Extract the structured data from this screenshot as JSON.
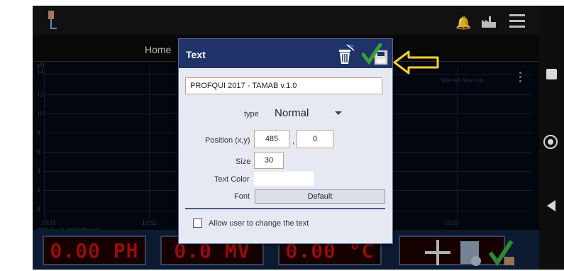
{
  "tabs": {
    "home": "Home"
  },
  "graph": {
    "ylabel": "pH",
    "yticks": [
      "14",
      "12",
      "10",
      "8",
      "6",
      "4",
      "2",
      "0"
    ],
    "xticks": [
      "10:51",
      "10:52",
      "10:55"
    ],
    "minmax": "Min=0.0  Max=0.0",
    "timestamp": "2019 fev 24, 10:50:49 = pH"
  },
  "readouts": [
    "0.00 PH",
    "0.0 MV",
    "0.00 °C"
  ],
  "dialog": {
    "title": "Text",
    "text_value": "PROFQUI 2017 - TAMAB v.1.0",
    "type_label": "type",
    "type_value": "Normal",
    "position_label": "Position (x,y)",
    "pos_x": "485",
    "pos_sep": ",",
    "pos_y": "0",
    "size_label": "Size",
    "size_value": "30",
    "text_color_label": "Text Color",
    "font_label": "Font",
    "font_value": "Default",
    "allow_label": "Allow user to change the text"
  },
  "icons": {
    "app": "sensor-probe-icon",
    "bell": "bell-icon",
    "factory": "factory-icon",
    "menu": "menu-icon",
    "trash": "trash-icon",
    "save": "save-check-icon",
    "arrow": "arrow-left-icon"
  },
  "colors": {
    "header": "#1f3368",
    "dialog_bg": "#e6e9f2",
    "readout": "#b01010",
    "arrow": "#f2d22a"
  }
}
